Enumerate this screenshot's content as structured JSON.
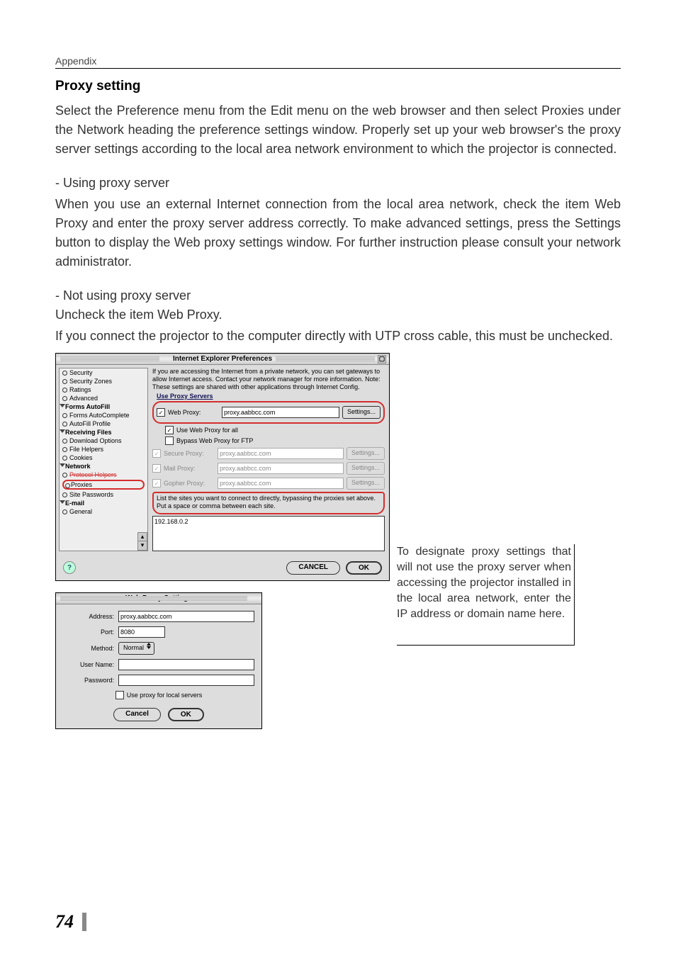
{
  "page": {
    "header": "Appendix",
    "number": "74"
  },
  "section": {
    "title": "Proxy setting",
    "intro_pre": "Select the ",
    "intro_w1": "Preference",
    "intro_mid1": " menu from the ",
    "intro_w2": "Edit",
    "intro_mid2": " menu on the web browser and then select ",
    "intro_w3": "Proxies",
    "intro_mid3": " under the ",
    "intro_w4": "Network",
    "intro_tail": " heading the preference settings window. Properly set up your web browser's the proxy server settings according to the local area network environment to which the projector is connected.",
    "using_h": "- Using proxy server",
    "using_pre": "When you use an external Internet connection from the local area network, check the item ",
    "using_w1": "Web Proxy",
    "using_mid1": " and enter the proxy server address correctly. To make advanced settings, press the ",
    "using_w2": "Settings",
    "using_tail": " button to display the Web proxy settings window. For further instruction please consult your network administrator.",
    "notusing_h": "- Not using proxy server",
    "notusing_pre": "Uncheck the item ",
    "notusing_w1": "Web Proxy",
    "notusing_post": ".",
    "notusing_p2": "If you connect the projector to the computer directly with UTP cross cable, this must be unchecked."
  },
  "dialog1": {
    "title": "Internet Explorer Preferences",
    "sidebar": {
      "items": [
        {
          "type": "item",
          "label": "Security"
        },
        {
          "type": "item",
          "label": "Security Zones"
        },
        {
          "type": "item",
          "label": "Ratings"
        },
        {
          "type": "item",
          "label": "Advanced"
        },
        {
          "type": "group",
          "label": "Forms AutoFill"
        },
        {
          "type": "item",
          "label": "Forms AutoComplete"
        },
        {
          "type": "item",
          "label": "AutoFill Profile"
        },
        {
          "type": "group",
          "label": "Receiving Files"
        },
        {
          "type": "item",
          "label": "Download Options"
        },
        {
          "type": "item",
          "label": "File Helpers"
        },
        {
          "type": "item",
          "label": "Cookies"
        },
        {
          "type": "group",
          "label": "Network"
        },
        {
          "type": "item",
          "label": "Protocol Helpers"
        },
        {
          "type": "highlight",
          "label": "Proxies"
        },
        {
          "type": "item",
          "label": "Site Passwords"
        },
        {
          "type": "group",
          "label": "E-mail"
        },
        {
          "type": "item",
          "label": "General"
        }
      ]
    },
    "info": "If you are accessing the Internet from a private network, you can set gateways to allow Internet access. Contact your network manager for more information. Note: These settings are shared with other applications through Internet Config.",
    "use_link": "Use Proxy Servers",
    "rows": {
      "web": {
        "label": "Web Proxy:",
        "value": "proxy.aabbcc.com",
        "btn": "Settings..."
      },
      "useall": "Use Web Proxy for all",
      "bypass": "Bypass Web Proxy for FTP",
      "secure": {
        "label": "Secure Proxy:",
        "value": "proxy.aabbcc.com",
        "btn": "Settings..."
      },
      "mail": {
        "label": "Mail Proxy:",
        "value": "proxy.aabbcc.com",
        "btn": "Settings..."
      },
      "gopher": {
        "label": "Gopher Proxy:",
        "value": "proxy.aabbcc.com",
        "btn": "Settings..."
      }
    },
    "bypass_text": "List the sites you want to connect to directly, bypassing the proxies set above. Put a space or comma between each site.",
    "bypass_value": "192.168.0.2",
    "footer": {
      "cancel": "CANCEL",
      "ok": "OK"
    }
  },
  "dialog2": {
    "title": "Web Proxy Settings",
    "address_label": "Address:",
    "address_value": "proxy.aabbcc.com",
    "port_label": "Port:",
    "port_value": "8080",
    "method_label": "Method:",
    "method_value": "Normal",
    "user_label": "User Name:",
    "user_value": "",
    "pass_label": "Password:",
    "pass_value": "",
    "local_chk": "Use proxy for local servers",
    "cancel": "Cancel",
    "ok": "OK"
  },
  "sidenote": "To designate proxy settings that will not use the proxy server when accessing the projector installed in the local area network, enter the IP address or domain name here."
}
